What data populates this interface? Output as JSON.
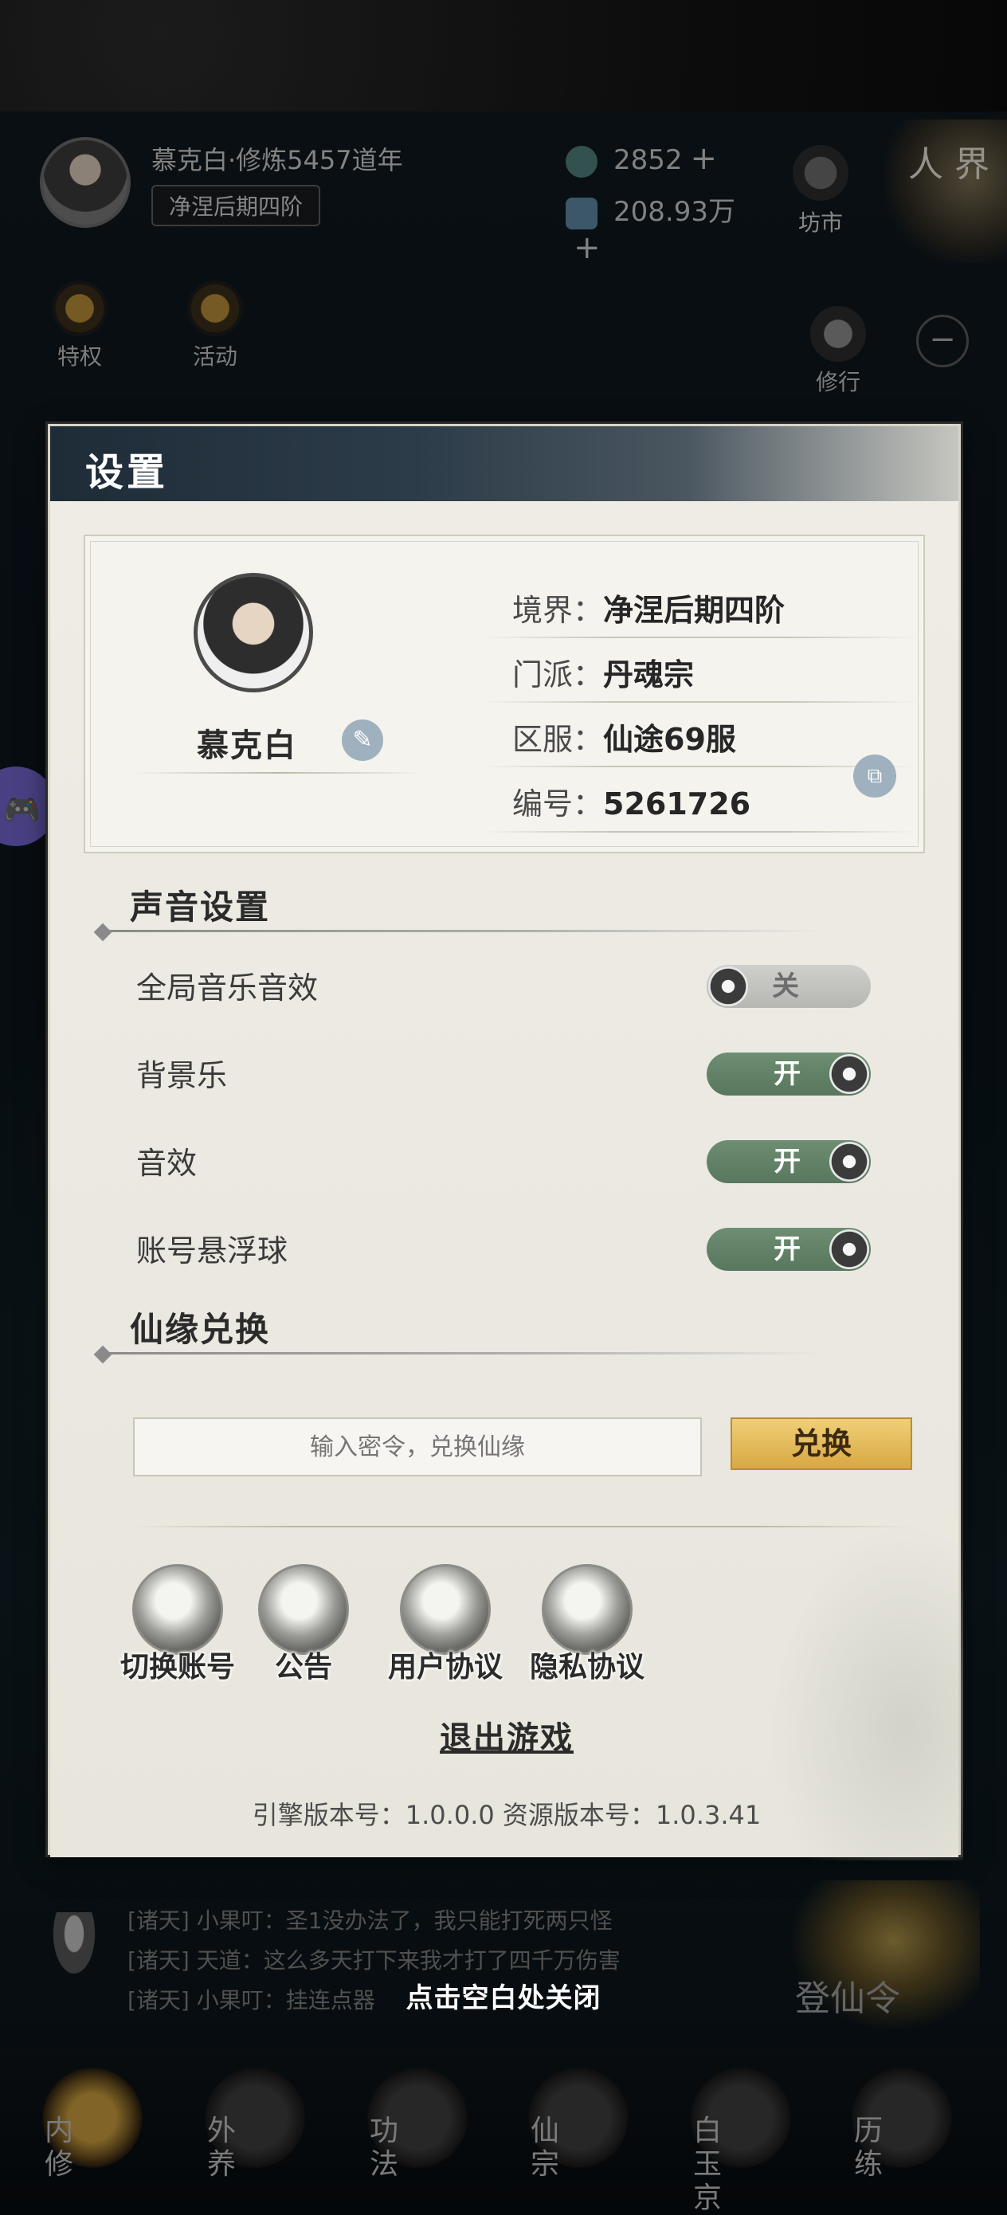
{
  "hud": {
    "player_name": "慕克白·修炼5457道年",
    "realm_tag": "净涅后期四阶",
    "currency_1": "2852",
    "currency_2": "208.93万",
    "plus": "+",
    "market_label": "坊市",
    "privilege_label": "特权",
    "event_label": "活动",
    "practice_label": "修行",
    "world_label": "人 界",
    "minus": "−"
  },
  "dialog": {
    "title": "设置",
    "profile": {
      "name": "慕克白",
      "rows": [
        {
          "label": "境界：",
          "value": "净涅后期四阶"
        },
        {
          "label": "门派：",
          "value": "丹魂宗"
        },
        {
          "label": "区服：",
          "value": "仙途69服"
        },
        {
          "label": "编号：",
          "value": "5261726"
        }
      ]
    },
    "sound_section_title": "声音设置",
    "settings": [
      {
        "label": "全局音乐音效",
        "state": "关",
        "on": false
      },
      {
        "label": "背景乐",
        "state": "开",
        "on": true
      },
      {
        "label": "音效",
        "state": "开",
        "on": true
      },
      {
        "label": "账号悬浮球",
        "state": "开",
        "on": true
      }
    ],
    "redeem_section_title": "仙缘兑换",
    "redeem_placeholder": "输入密令，兑换仙缘",
    "redeem_button": "兑换",
    "actions": [
      {
        "label": "切换账号",
        "icon": "switch-account-icon"
      },
      {
        "label": "公告",
        "icon": "scroll-icon"
      },
      {
        "label": "用户协议",
        "icon": "agreement-icon"
      },
      {
        "label": "隐私协议",
        "icon": "book-icon"
      }
    ],
    "logout": "退出游戏",
    "version": "引擎版本号：1.0.0.0 资源版本号：1.0.3.41"
  },
  "chat": {
    "lines": [
      "[诸天] 小果叮：圣1没办法了，我只能打死两只怪",
      "[诸天] 天道：这么多天打下来我才打了四千万伤害",
      "[诸天] 小果叮：挂连点器"
    ]
  },
  "close_hint": "点击空白处关闭",
  "dengxian_label": "登仙令",
  "bottom_tabs": [
    {
      "label": "内修",
      "active": true
    },
    {
      "label": "外养",
      "active": false
    },
    {
      "label": "功法",
      "active": false
    },
    {
      "label": "仙宗",
      "active": false
    },
    {
      "label": "白玉京",
      "active": false
    },
    {
      "label": "历练",
      "active": false
    }
  ],
  "colors": {
    "toggle_on": "#6d8e73",
    "toggle_off": "#cfcfcb",
    "redeem_button": "#e6bb5a",
    "dialog_bg": "#eceae2",
    "gamepad": "#7063c9"
  }
}
